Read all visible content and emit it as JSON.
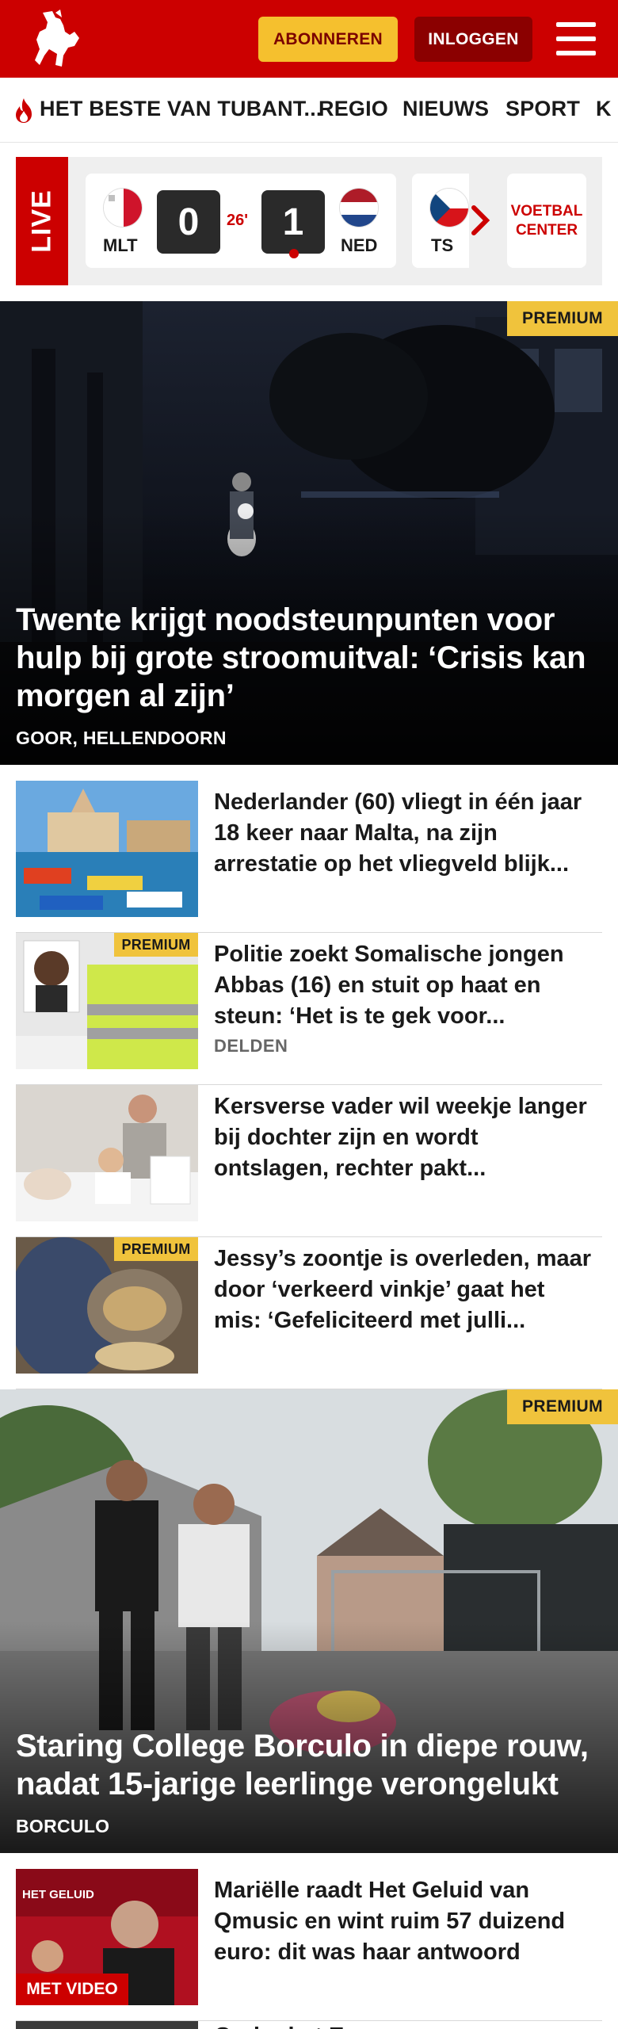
{
  "header": {
    "logo_name": "tubantia-horse-logo",
    "subscribe_label": "ABONNEREN",
    "login_label": "INLOGGEN",
    "menu_icon": "hamburger-menu-icon"
  },
  "nav": {
    "items": [
      {
        "label": "HET BESTE VAN TUBANT..."
      },
      {
        "label": "REGIO"
      },
      {
        "label": "NIEUWS"
      },
      {
        "label": "SPORT"
      },
      {
        "label": "K"
      }
    ]
  },
  "live": {
    "tab_label": "LIVE",
    "match": {
      "home_code": "MLT",
      "home_score": "0",
      "minute": "26'",
      "away_score": "1",
      "away_code": "NED"
    },
    "next_code": "TS",
    "football_center_label": "VOETBAL CENTER"
  },
  "hero1": {
    "premium_label": "PREMIUM",
    "title": "Twente krijgt noodsteunpunten voor hulp bij grote stroomuitval: ‘Crisis kan morgen al zijn’",
    "location": "GOOR, HELLENDOORN"
  },
  "articles": [
    {
      "title": "Nederlander (60) vliegt in één jaar 18 keer naar Malta, na zijn arrestatie op het vliegveld blijk...",
      "location": "",
      "premium": ""
    },
    {
      "title": "Politie zoekt Somalische jongen Abbas (16) en stuit op haat en steun: ‘Het is te gek voor...",
      "location": "DELDEN",
      "premium": "PREMIUM"
    },
    {
      "title": "Kersverse vader wil weekje langer bij dochter zijn en wordt ontslagen, rechter pakt...",
      "location": "",
      "premium": ""
    },
    {
      "title": "Jessy’s zoontje is overleden, maar door ‘verkeerd vinkje’ gaat het mis: ‘Gefeliciteerd met julli...",
      "location": "",
      "premium": "PREMIUM"
    }
  ],
  "hero2": {
    "premium_label": "PREMIUM",
    "title": "Staring College Borculo in diepe rouw, nadat 15-jarige leerlinge verongelukt",
    "location": "BORCULO"
  },
  "articles2": [
    {
      "title": "Mariëlle raadt Het Geluid van Qmusic en wint ruim 57 duizend euro: dit was haar antwoord",
      "badge": "MET VIDEO",
      "thumb_text": "HET GELUID"
    }
  ],
  "partial_article": {
    "title": "Onder het E"
  }
}
